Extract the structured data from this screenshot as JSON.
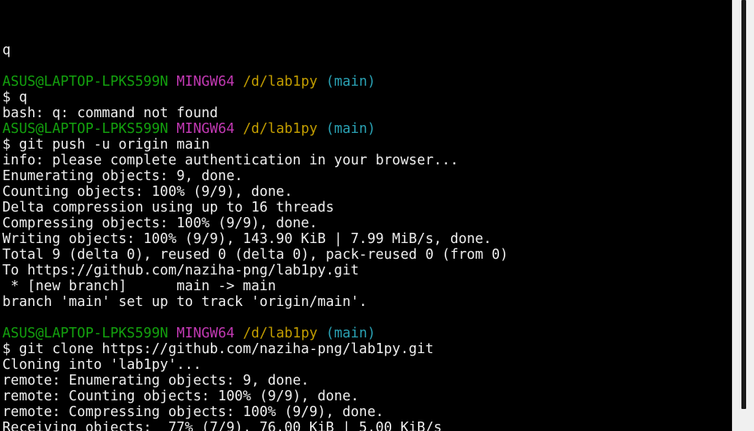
{
  "colors": {
    "default_text": "#eeeeee",
    "background": "#000000",
    "prompt_user": "#13a10e",
    "prompt_system": "#c239b3",
    "prompt_path": "#c19c00",
    "prompt_branch": "#2aa1b3"
  },
  "terminal": {
    "lines": [
      [],
      [
        {
          "text": "q"
        }
      ],
      [],
      [
        {
          "text": "ASUS@LAPTOP-LPKS599N",
          "color": "#13a10e"
        },
        {
          "text": " "
        },
        {
          "text": "MINGW64",
          "color": "#c239b3"
        },
        {
          "text": " "
        },
        {
          "text": "/d/lab1py",
          "color": "#c19c00"
        },
        {
          "text": " "
        },
        {
          "text": "(main)",
          "color": "#2aa1b3"
        }
      ],
      [
        {
          "text": "$ q"
        }
      ],
      [
        {
          "text": "bash: q: command not found"
        }
      ],
      [
        {
          "text": "ASUS@LAPTOP-LPKS599N",
          "color": "#13a10e"
        },
        {
          "text": " "
        },
        {
          "text": "MINGW64",
          "color": "#c239b3"
        },
        {
          "text": " "
        },
        {
          "text": "/d/lab1py",
          "color": "#c19c00"
        },
        {
          "text": " "
        },
        {
          "text": "(main)",
          "color": "#2aa1b3"
        }
      ],
      [
        {
          "text": "$ git push -u origin main"
        }
      ],
      [
        {
          "text": "info: please complete authentication in your browser..."
        }
      ],
      [
        {
          "text": "Enumerating objects: 9, done."
        }
      ],
      [
        {
          "text": "Counting objects: 100% (9/9), done."
        }
      ],
      [
        {
          "text": "Delta compression using up to 16 threads"
        }
      ],
      [
        {
          "text": "Compressing objects: 100% (9/9), done."
        }
      ],
      [
        {
          "text": "Writing objects: 100% (9/9), 143.90 KiB | 7.99 MiB/s, done."
        }
      ],
      [
        {
          "text": "Total 9 (delta 0), reused 0 (delta 0), pack-reused 0 (from 0)"
        }
      ],
      [
        {
          "text": "To https://github.com/naziha-png/lab1py.git"
        }
      ],
      [
        {
          "text": " * [new branch]      main -> main"
        }
      ],
      [
        {
          "text": "branch 'main' set up to track 'origin/main'."
        }
      ],
      [],
      [
        {
          "text": "ASUS@LAPTOP-LPKS599N",
          "color": "#13a10e"
        },
        {
          "text": " "
        },
        {
          "text": "MINGW64",
          "color": "#c239b3"
        },
        {
          "text": " "
        },
        {
          "text": "/d/lab1py",
          "color": "#c19c00"
        },
        {
          "text": " "
        },
        {
          "text": "(main)",
          "color": "#2aa1b3"
        }
      ],
      [
        {
          "text": "$ git clone https://github.com/naziha-png/lab1py.git"
        }
      ],
      [
        {
          "text": "Cloning into 'lab1py'..."
        }
      ],
      [
        {
          "text": "remote: Enumerating objects: 9, done."
        }
      ],
      [
        {
          "text": "remote: Counting objects: 100% (9/9), done."
        }
      ],
      [
        {
          "text": "remote: Compressing objects: 100% (9/9), done."
        }
      ],
      [
        {
          "text": "Receiving objects:  77% (7/9), 76.00 KiB | 5.00 KiB/s"
        }
      ]
    ]
  }
}
